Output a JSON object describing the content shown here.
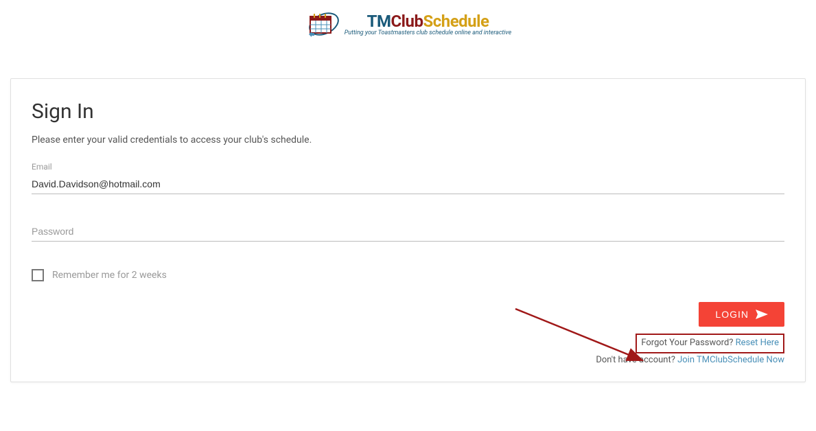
{
  "logo": {
    "prefix": "TM",
    "middle": "Club",
    "suffix": "Schedule",
    "tagline": "Putting your Toastmasters club schedule online and interactive"
  },
  "signin": {
    "title": "Sign In",
    "subtitle": "Please enter your valid credentials to access your club's schedule.",
    "email_label": "Email",
    "email_value": "David.Davidson@hotmail.com",
    "password_placeholder": "Password",
    "password_value": "",
    "remember_label": "Remember me for 2 weeks",
    "login_button": "LOGIN",
    "forgot_text": "Forgot Your Password? ",
    "forgot_link": "Reset Here",
    "noaccount_text": "Don't have account? ",
    "noaccount_link": "Join TMClubSchedule Now"
  }
}
